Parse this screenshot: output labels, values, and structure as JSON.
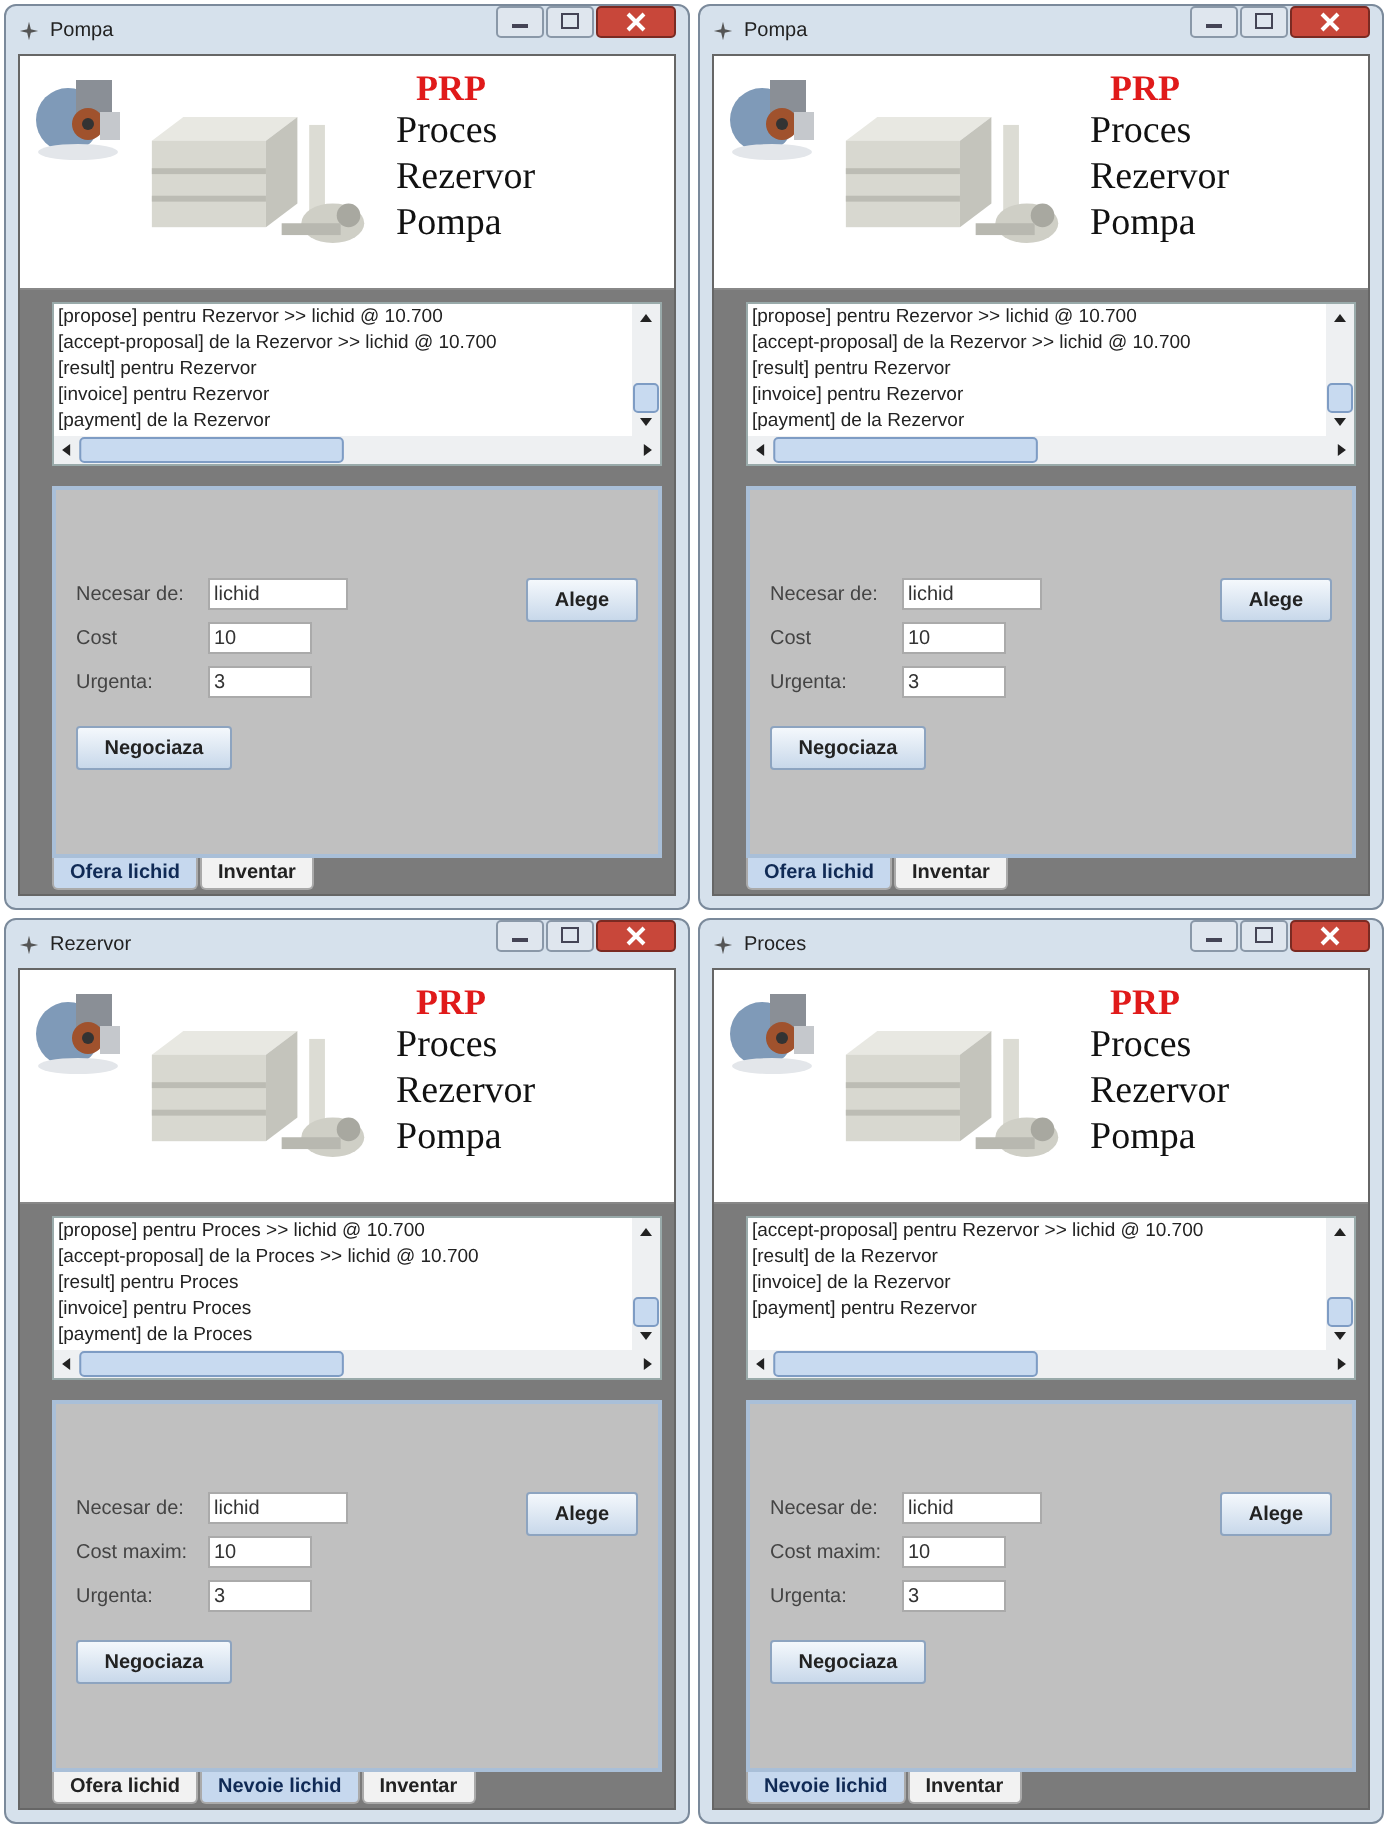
{
  "windows": [
    {
      "title": "Pompa",
      "banner": {
        "heading": "PRP",
        "lines": [
          "Proces",
          "Rezervor",
          "Pompa"
        ]
      },
      "log": [
        "[propose] pentru Rezervor >> lichid @ 10.700",
        "[accept-proposal] de la Rezervor >> lichid @ 10.700",
        "[result] pentru Rezervor",
        "[invoice] pentru Rezervor",
        "[payment] de la Rezervor"
      ],
      "fields": [
        {
          "label": "Necesar de:",
          "value": "lichid"
        },
        {
          "label": "Cost",
          "value": "10"
        },
        {
          "label": "Urgenta:",
          "value": "3"
        }
      ],
      "choose_button": "Alege",
      "negotiate_button": "Negociaza",
      "tabs": [
        {
          "label": "Ofera lichid",
          "selected": true
        },
        {
          "label": "Inventar",
          "selected": false
        }
      ]
    },
    {
      "title": "Pompa",
      "banner": {
        "heading": "PRP",
        "lines": [
          "Proces",
          "Rezervor",
          "Pompa"
        ]
      },
      "log": [
        "[propose] pentru Rezervor >> lichid @ 10.700",
        "[accept-proposal] de la Rezervor >> lichid @ 10.700",
        "[result] pentru Rezervor",
        "[invoice] pentru Rezervor",
        "[payment] de la Rezervor"
      ],
      "fields": [
        {
          "label": "Necesar de:",
          "value": "lichid"
        },
        {
          "label": "Cost",
          "value": "10"
        },
        {
          "label": "Urgenta:",
          "value": "3"
        }
      ],
      "choose_button": "Alege",
      "negotiate_button": "Negociaza",
      "tabs": [
        {
          "label": "Ofera lichid",
          "selected": true
        },
        {
          "label": "Inventar",
          "selected": false
        }
      ]
    },
    {
      "title": "Rezervor",
      "banner": {
        "heading": "PRP",
        "lines": [
          "Proces",
          "Rezervor",
          "Pompa"
        ]
      },
      "log": [
        "[propose] pentru Proces >> lichid @ 10.700",
        "[accept-proposal] de la Proces >> lichid @ 10.700",
        "[result] pentru Proces",
        "[invoice] pentru Proces",
        "[payment] de la Proces"
      ],
      "fields": [
        {
          "label": "Necesar de:",
          "value": "lichid"
        },
        {
          "label": "Cost maxim:",
          "value": "10"
        },
        {
          "label": "Urgenta:",
          "value": "3"
        }
      ],
      "choose_button": "Alege",
      "negotiate_button": "Negociaza",
      "tabs": [
        {
          "label": "Ofera lichid",
          "selected": false
        },
        {
          "label": "Nevoie lichid",
          "selected": true
        },
        {
          "label": "Inventar",
          "selected": false
        }
      ]
    },
    {
      "title": "Proces",
      "banner": {
        "heading": "PRP",
        "lines": [
          "Proces",
          "Rezervor",
          "Pompa"
        ]
      },
      "log": [
        "[accept-proposal] pentru Rezervor >> lichid @ 10.700",
        "[result] de la Rezervor",
        "[invoice] de la Rezervor",
        "[payment] pentru Rezervor"
      ],
      "fields": [
        {
          "label": "Necesar de:",
          "value": "lichid"
        },
        {
          "label": "Cost maxim:",
          "value": "10"
        },
        {
          "label": "Urgenta:",
          "value": "3"
        }
      ],
      "choose_button": "Alege",
      "negotiate_button": "Negociaza",
      "tabs": [
        {
          "label": "Nevoie lichid",
          "selected": true
        },
        {
          "label": "Inventar",
          "selected": false
        }
      ]
    }
  ]
}
